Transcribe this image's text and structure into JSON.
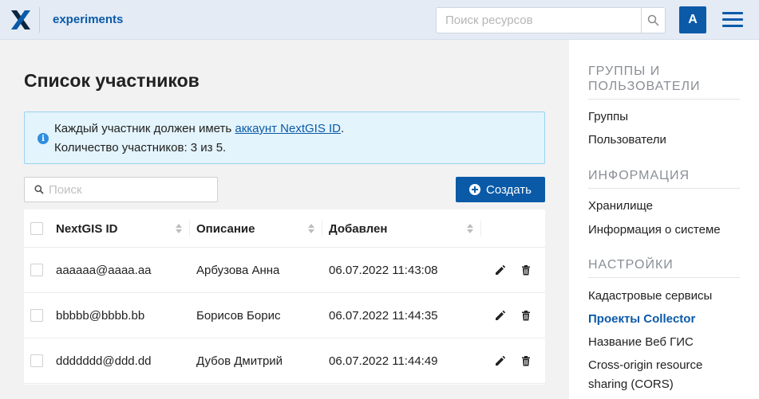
{
  "header": {
    "app_title": "experiments",
    "search_placeholder": "Поиск ресурсов",
    "avatar_letter": "A",
    "brand_color": "#0a5aa8"
  },
  "main": {
    "title": "Список участников",
    "info": {
      "line1_prefix": "Каждый участник должен иметь ",
      "line1_link": "аккаунт NextGIS ID",
      "line1_suffix": ".",
      "line2": "Количество участников: 3 из 5."
    },
    "filter_placeholder": "Поиск",
    "create_label": "Создать",
    "columns": [
      "NextGIS ID",
      "Описание",
      "Добавлен"
    ],
    "rows": [
      {
        "id": "aaaaaa@aaaa.aa",
        "description": "Арбузова Анна",
        "added": "06.07.2022 11:43:08"
      },
      {
        "id": "bbbbb@bbbb.bb",
        "description": "Борисов Борис",
        "added": "06.07.2022 11:44:35"
      },
      {
        "id": "ddddddd@ddd.dd",
        "description": "Дубов Дмитрий",
        "added": "06.07.2022 11:44:49"
      }
    ]
  },
  "sidebar": {
    "sections": [
      {
        "heading": "Группы и пользователи",
        "items": [
          "Группы",
          "Пользователи"
        ]
      },
      {
        "heading": "Информация",
        "items": [
          "Хранилище",
          "Информация о системе"
        ]
      },
      {
        "heading": "Настройки",
        "items": [
          "Кадастровые сервисы",
          "Проекты Collector",
          "Название Веб ГИС",
          "Cross-origin resource",
          "sharing (CORS)"
        ]
      }
    ],
    "heading_line2": "пользователи",
    "heading_line1": "Группы и"
  }
}
